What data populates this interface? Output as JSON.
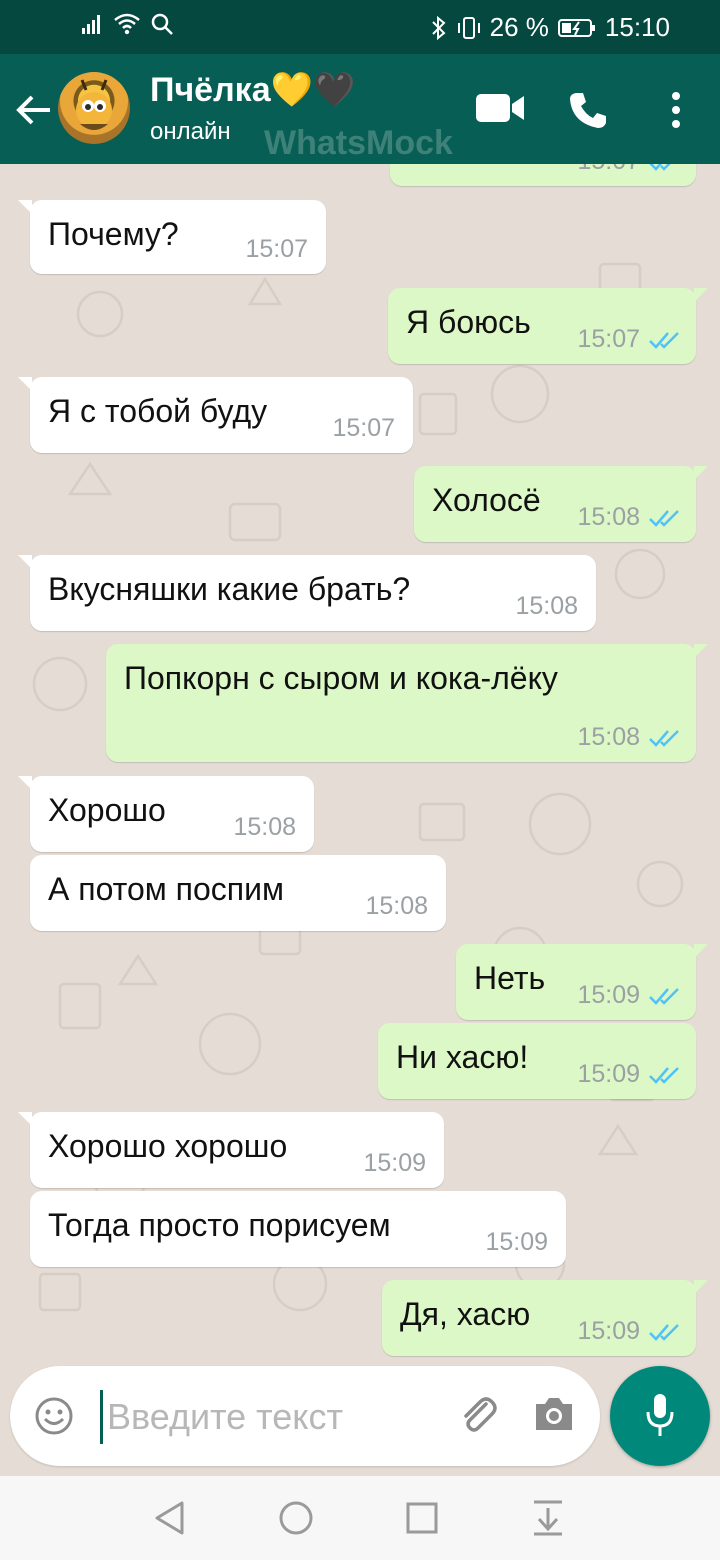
{
  "status_bar": {
    "time": "15:10",
    "battery": "26 %",
    "colors": {
      "bar": "#05483f"
    }
  },
  "header": {
    "contact_name": "Пчёлка💛🖤",
    "presence": "онлайн",
    "watermark": "WhatsMock",
    "colors": {
      "bar": "#075e54"
    }
  },
  "messages": [
    {
      "dir": "out",
      "text": "",
      "time": "15:07",
      "partial": true
    },
    {
      "dir": "in",
      "text": "Почему?",
      "time": "15:07"
    },
    {
      "dir": "out",
      "text": "Я боюсь",
      "time": "15:07"
    },
    {
      "dir": "in",
      "text": "Я с тобой буду",
      "time": "15:07"
    },
    {
      "dir": "out",
      "text": "Холосё",
      "time": "15:08"
    },
    {
      "dir": "in",
      "text": "Вкусняшки какие брать?",
      "time": "15:08"
    },
    {
      "dir": "out",
      "text": "Попкорн с сыром и кока-лёку",
      "time": "15:08"
    },
    {
      "dir": "in",
      "text": "Хорошо",
      "time": "15:08"
    },
    {
      "dir": "in",
      "text": "А потом поспим",
      "time": "15:08"
    },
    {
      "dir": "out",
      "text": "Неть",
      "time": "15:09"
    },
    {
      "dir": "out",
      "text": "Ни хасю!",
      "time": "15:09"
    },
    {
      "dir": "in",
      "text": "Хорошо хорошо",
      "time": "15:09"
    },
    {
      "dir": "in",
      "text": "Тогда просто порисуем",
      "time": "15:09"
    },
    {
      "dir": "out",
      "text": "Дя, хасю",
      "time": "15:09"
    }
  ],
  "input": {
    "placeholder": "Введите текст",
    "value": ""
  },
  "colors": {
    "chat_bg": "#e5ddd5",
    "bubble_in": "#ffffff",
    "bubble_out": "#dcf8c6",
    "ticks": "#4fc3f7",
    "accent": "#00897b"
  },
  "icons": [
    "signal-icon",
    "wifi-icon",
    "search-icon",
    "bluetooth-icon",
    "vibrate-icon",
    "battery-icon",
    "back-arrow-icon",
    "video-call-icon",
    "phone-icon",
    "more-vert-icon",
    "emoji-icon",
    "attach-icon",
    "camera-icon",
    "mic-icon",
    "nav-back-icon",
    "nav-home-icon",
    "nav-recents-icon",
    "nav-notifications-icon"
  ]
}
